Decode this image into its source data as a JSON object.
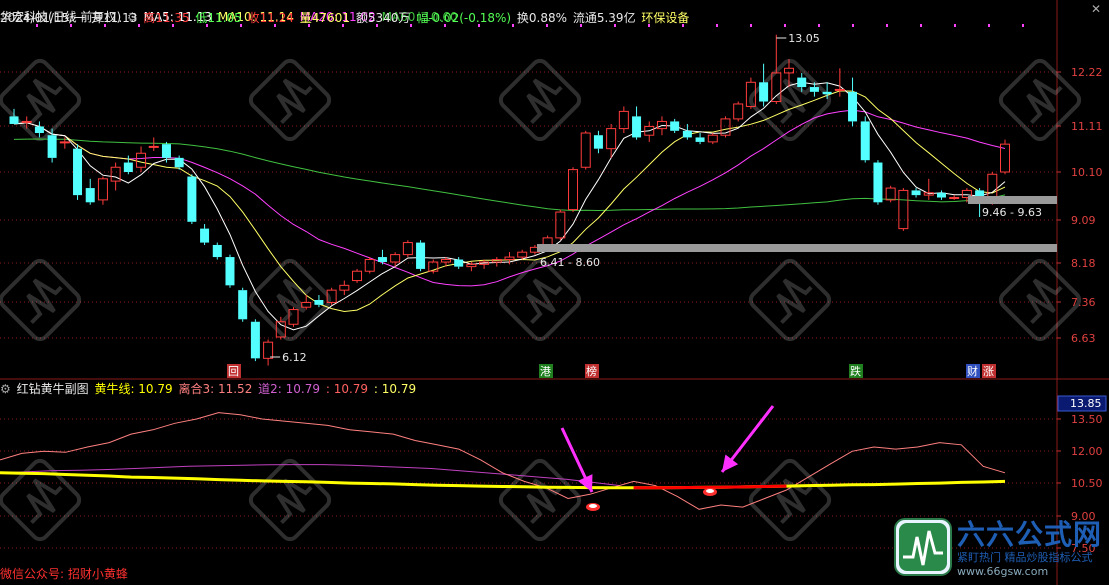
{
  "header": {
    "name": "华宏科技(日线 前复权)",
    "ma5": "MA5: 11.13",
    "ma10": "MA10: 11.14",
    "ma20": "MA20: 11.02",
    "ma60": "MA60: 10.60",
    "date": "2024/01/15/一",
    "open": "开11.13",
    "high": "高11.35",
    "low": "低11.05",
    "close": "收11.24",
    "vol": "量47601",
    "amt": "额5340万",
    "chg": "幅-0.02(-0.18%)",
    "turn": "换0.88%",
    "float": "流通5.39亿",
    "sector": "环保设备"
  },
  "sub_header": {
    "title": "红钻黄牛副图",
    "yellow_line": "黄牛线: 10.79",
    "lihe": "离合3: 11.52",
    "dao": "道2: 10.79",
    "v4": ": 10.79",
    "v5": ": 10.79"
  },
  "footer_text": "微信公众号: 招财小黄蜂",
  "watermark": {
    "brand": "六六公式网",
    "slogan": "紧盯热门 精品炒股指标公式",
    "url": "www.66gsw.com"
  },
  "colors": {
    "up": "#ff3c3c",
    "down": "#54ffff",
    "ma5": "#ffffff",
    "ma10": "#ffff66",
    "ma20": "#ff40ff",
    "ma60": "#40c040",
    "grid": "#8b1a1a",
    "yellow_line": "#ffff00",
    "pink_line": "#ff8080",
    "purple_line": "#c040c0",
    "red_segment": "#ff0000",
    "arrow": "#ff30ff"
  },
  "chart_data": [
    {
      "type": "candlestick",
      "title": "华宏科技(日线 前复权)",
      "y_ticks": [
        12.22,
        11.11,
        10.1,
        9.09,
        8.18,
        7.36,
        6.63
      ],
      "price_axis": "log",
      "ylim": [
        6.12,
        13.05
      ],
      "ohlc": [
        [
          11.3,
          11.45,
          11.15,
          11.15
        ],
        [
          11.2,
          11.3,
          11.05,
          11.2
        ],
        [
          11.1,
          11.2,
          10.85,
          10.95
        ],
        [
          10.9,
          11.05,
          10.3,
          10.4
        ],
        [
          10.75,
          10.85,
          10.6,
          10.75
        ],
        [
          10.6,
          10.7,
          9.5,
          9.6
        ],
        [
          9.75,
          9.95,
          9.4,
          9.45
        ],
        [
          9.5,
          10.0,
          9.4,
          9.95
        ],
        [
          9.9,
          10.3,
          9.7,
          10.2
        ],
        [
          10.3,
          10.45,
          10.05,
          10.1
        ],
        [
          10.2,
          10.65,
          10.1,
          10.5
        ],
        [
          10.65,
          10.85,
          10.55,
          10.65
        ],
        [
          10.7,
          10.75,
          10.3,
          10.4
        ],
        [
          10.4,
          10.45,
          10.15,
          10.2
        ],
        [
          10.0,
          10.05,
          9.0,
          9.05
        ],
        [
          8.9,
          9.0,
          8.55,
          8.6
        ],
        [
          8.55,
          8.6,
          8.25,
          8.3
        ],
        [
          8.3,
          8.35,
          7.65,
          7.7
        ],
        [
          7.6,
          7.65,
          6.95,
          7.0
        ],
        [
          6.95,
          7.0,
          6.2,
          6.25
        ],
        [
          6.25,
          6.6,
          6.12,
          6.55
        ],
        [
          6.65,
          7.05,
          6.6,
          6.95
        ],
        [
          6.9,
          7.25,
          6.85,
          7.2
        ],
        [
          7.25,
          7.5,
          7.2,
          7.35
        ],
        [
          7.4,
          7.5,
          7.25,
          7.3
        ],
        [
          7.35,
          7.65,
          7.3,
          7.6
        ],
        [
          7.6,
          7.8,
          7.5,
          7.7
        ],
        [
          7.8,
          8.05,
          7.75,
          8.0
        ],
        [
          8.0,
          8.3,
          7.95,
          8.25
        ],
        [
          8.3,
          8.45,
          8.15,
          8.2
        ],
        [
          8.2,
          8.4,
          8.1,
          8.35
        ],
        [
          8.35,
          8.65,
          8.3,
          8.6
        ],
        [
          8.6,
          8.65,
          8.0,
          8.05
        ],
        [
          8.0,
          8.25,
          7.95,
          8.2
        ],
        [
          8.2,
          8.3,
          8.1,
          8.25
        ],
        [
          8.25,
          8.3,
          8.05,
          8.1
        ],
        [
          8.1,
          8.2,
          8.0,
          8.15
        ],
        [
          8.15,
          8.25,
          8.05,
          8.2
        ],
        [
          8.2,
          8.3,
          8.1,
          8.25
        ],
        [
          8.25,
          8.4,
          8.15,
          8.3
        ],
        [
          8.3,
          8.45,
          8.25,
          8.4
        ],
        [
          8.4,
          8.55,
          8.35,
          8.5
        ],
        [
          8.5,
          8.75,
          8.45,
          8.7
        ],
        [
          8.7,
          9.3,
          8.65,
          9.25
        ],
        [
          9.3,
          10.2,
          9.25,
          10.15
        ],
        [
          10.2,
          11.0,
          10.15,
          10.95
        ],
        [
          10.9,
          11.0,
          10.5,
          10.6
        ],
        [
          10.6,
          11.15,
          10.4,
          11.05
        ],
        [
          11.05,
          11.5,
          10.95,
          11.4
        ],
        [
          11.3,
          11.5,
          10.8,
          10.85
        ],
        [
          10.9,
          11.2,
          10.75,
          11.1
        ],
        [
          11.05,
          11.3,
          10.9,
          11.2
        ],
        [
          11.2,
          11.25,
          10.95,
          11.0
        ],
        [
          11.0,
          11.15,
          10.8,
          10.85
        ],
        [
          10.85,
          10.95,
          10.7,
          10.75
        ],
        [
          10.75,
          10.95,
          10.7,
          10.9
        ],
        [
          10.9,
          11.3,
          10.85,
          11.25
        ],
        [
          11.25,
          11.6,
          11.2,
          11.55
        ],
        [
          11.5,
          12.1,
          11.45,
          12.0
        ],
        [
          12.0,
          12.4,
          11.5,
          11.6
        ],
        [
          11.6,
          13.05,
          11.55,
          12.2
        ],
        [
          12.2,
          12.5,
          11.9,
          12.3
        ],
        [
          12.1,
          12.2,
          11.8,
          11.9
        ],
        [
          11.9,
          12.0,
          11.7,
          11.8
        ],
        [
          11.8,
          12.0,
          11.65,
          11.75
        ],
        [
          11.85,
          12.3,
          11.7,
          11.85
        ],
        [
          11.8,
          12.1,
          11.1,
          11.2
        ],
        [
          11.2,
          11.3,
          10.3,
          10.35
        ],
        [
          10.3,
          10.35,
          9.4,
          9.45
        ],
        [
          9.5,
          9.8,
          9.45,
          9.75
        ],
        [
          8.9,
          9.75,
          8.85,
          9.7
        ],
        [
          9.7,
          9.75,
          9.55,
          9.6
        ],
        [
          9.6,
          9.95,
          9.5,
          9.65
        ],
        [
          9.65,
          9.7,
          9.5,
          9.55
        ],
        [
          9.55,
          9.6,
          9.5,
          9.55
        ],
        [
          9.55,
          9.75,
          9.45,
          9.7
        ],
        [
          9.7,
          9.75,
          9.15,
          9.45
        ],
        [
          9.45,
          10.1,
          9.4,
          10.05
        ],
        [
          10.1,
          10.8,
          10.05,
          10.7
        ]
      ],
      "annotations": [
        {
          "text": "13.05",
          "type": "high"
        },
        {
          "text": "6.12",
          "type": "low"
        },
        {
          "text": "6.41 - 8.60",
          "type": "range"
        },
        {
          "text": "9.46 - 9.63",
          "type": "range"
        }
      ],
      "event_markers": [
        "回",
        "港",
        "榜",
        "跌",
        "财",
        "涨"
      ]
    },
    {
      "type": "line",
      "title": "红钻黄牛副图",
      "y_ticks": [
        13.5,
        12.0,
        10.5,
        9.0,
        7.5
      ],
      "current_value": "13.85",
      "ylim": [
        7.5,
        13.85
      ],
      "series": [
        {
          "name": "黄牛线",
          "values": [
            11.0,
            10.98,
            10.96,
            10.92,
            10.88,
            10.85,
            10.8,
            10.78,
            10.75,
            10.72,
            10.68,
            10.65,
            10.62,
            10.6,
            10.58,
            10.55,
            10.52,
            10.5,
            10.48,
            10.45,
            10.42,
            10.4,
            10.38,
            10.36,
            10.35,
            10.33,
            10.32,
            10.31,
            10.3,
            10.3,
            10.3,
            10.31,
            10.32,
            10.33,
            10.34,
            10.36,
            10.38,
            10.4,
            10.42,
            10.44,
            10.45,
            10.47,
            10.5,
            10.52,
            10.55,
            10.57,
            10.6
          ]
        },
        {
          "name": "离合3",
          "values": [
            11.6,
            11.9,
            12.0,
            11.95,
            12.2,
            12.4,
            12.8,
            13.0,
            13.3,
            13.5,
            13.8,
            13.7,
            13.5,
            13.4,
            13.3,
            13.2,
            13.0,
            12.9,
            12.8,
            12.5,
            12.3,
            12.1,
            11.6,
            11.0,
            10.6,
            10.3,
            9.8,
            10.0,
            10.3,
            10.6,
            10.4,
            9.9,
            9.3,
            9.5,
            9.4,
            9.8,
            10.2,
            10.8,
            11.4,
            12.0,
            12.2,
            12.1,
            12.2,
            12.4,
            12.3,
            11.3,
            11.0
          ]
        },
        {
          "name": "道2",
          "values": [
            11.0,
            11.05,
            11.1,
            11.12,
            11.15,
            11.2,
            11.25,
            11.3,
            11.33,
            11.35,
            11.37,
            11.38,
            11.38,
            11.35,
            11.3,
            11.25,
            11.2,
            11.1,
            11.0,
            10.9,
            10.8,
            10.7,
            10.55,
            10.4
          ]
        }
      ],
      "markers": [
        "red_diamond_1",
        "red_diamond_2"
      ]
    }
  ]
}
